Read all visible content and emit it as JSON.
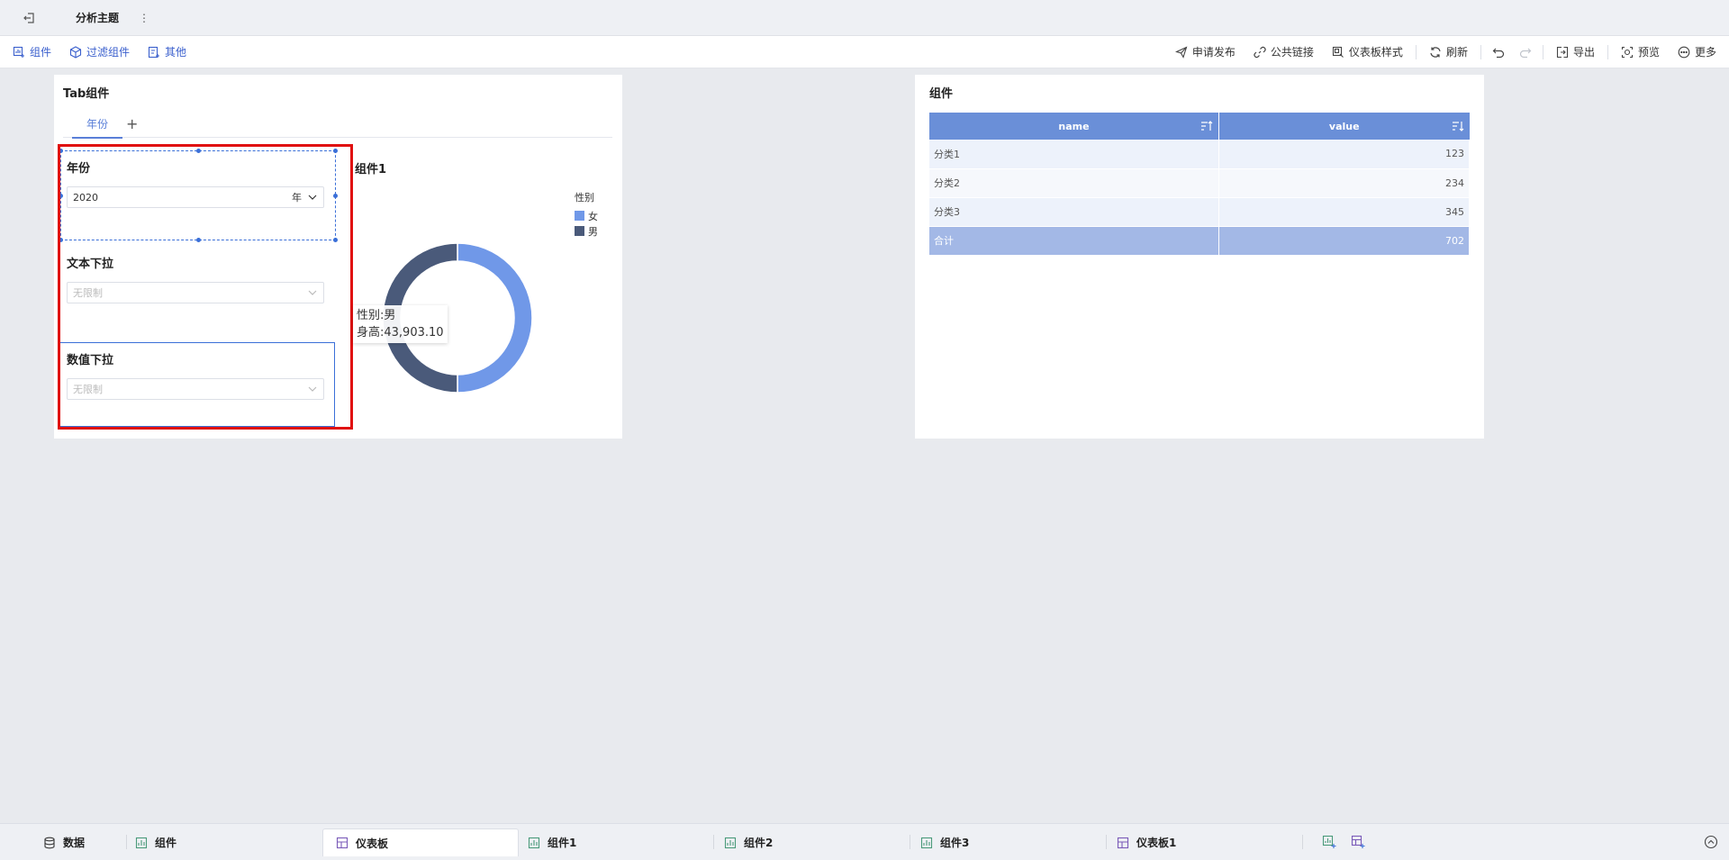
{
  "titlebar": {
    "title": "分析主题",
    "more": "⋮"
  },
  "toolbar": {
    "left": [
      {
        "label": "组件",
        "icon": "component-icon"
      },
      {
        "label": "过滤组件",
        "icon": "filter-component-icon"
      },
      {
        "label": "其他",
        "icon": "other-icon"
      }
    ],
    "publish": "申请发布",
    "public_link": "公共链接",
    "dashboard_style": "仪表板样式",
    "refresh": "刷新",
    "export": "导出",
    "preview": "预览",
    "more": "更多"
  },
  "tab_widget": {
    "title": "Tab组件",
    "tabs": [
      {
        "label": "年份"
      }
    ],
    "add": "+",
    "filters": {
      "year": {
        "title": "年份",
        "value": "2020",
        "suffix": "年"
      },
      "text_dropdown": {
        "title": "文本下拉",
        "placeholder": "无限制"
      },
      "number_dropdown": {
        "title": "数值下拉",
        "placeholder": "无限制"
      }
    }
  },
  "donut": {
    "title": "组件1",
    "legend_title": "性别",
    "tooltip": {
      "line1": "性别:男",
      "line2": "身高:43,903.10"
    }
  },
  "chart_data": {
    "type": "pie",
    "title": "组件1",
    "categories": [
      "女",
      "男"
    ],
    "values": [
      0.5,
      0.5
    ],
    "colors": [
      "#7098e8",
      "#4a5a7a"
    ],
    "legend": "top-right"
  },
  "table_widget": {
    "title": "组件",
    "columns": [
      "name",
      "value"
    ],
    "rows": [
      {
        "name": "分类1",
        "value": "123"
      },
      {
        "name": "分类2",
        "value": "234"
      },
      {
        "name": "分类3",
        "value": "345"
      }
    ],
    "total": {
      "name": "合计",
      "value": "702"
    }
  },
  "sheets": [
    {
      "label": "数据",
      "icon": "database-icon"
    },
    {
      "label": "组件",
      "icon": "chart-icon"
    },
    {
      "label": "仪表板",
      "icon": "dashboard-icon"
    },
    {
      "label": "组件1",
      "icon": "chart-icon"
    },
    {
      "label": "组件2",
      "icon": "chart-icon"
    },
    {
      "label": "组件3",
      "icon": "chart-icon"
    },
    {
      "label": "仪表板1",
      "icon": "dashboard-icon"
    }
  ]
}
